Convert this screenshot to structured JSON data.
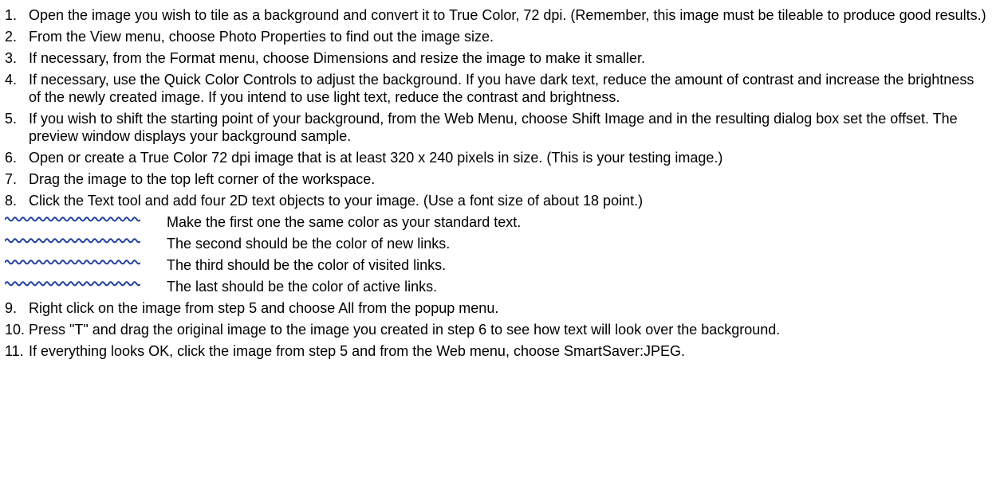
{
  "steps_before": [
    {
      "num": "1.",
      "text": "Open the image you wish to tile as a background and convert it to True Color, 72 dpi. (Remember, this image must be tileable to produce good results.)"
    },
    {
      "num": "2.",
      "text": "From the View menu, choose Photo Properties to find out the image size."
    },
    {
      "num": "3.",
      "text": "If necessary, from the Format menu, choose Dimensions and resize the image to make it smaller."
    },
    {
      "num": "4.",
      "text": "If necessary, use the Quick Color Controls to adjust the background. If you have dark text, reduce the amount of contrast and increase the brightness of the newly created image. If you intend to use light text, reduce the contrast and brightness."
    },
    {
      "num": "5.",
      "text": "If you wish to shift the starting point of your background, from the Web Menu, choose Shift Image and in the resulting dialog box set the offset. The preview window displays your background sample."
    },
    {
      "num": "6.",
      "text": "Open or create a True Color 72 dpi image that is at least 320 x 240 pixels in size. (This is your testing image.)"
    },
    {
      "num": "7.",
      "text": "Drag the image to the top left corner of the workspace."
    },
    {
      "num": "8.",
      "text": "Click the Text tool and add four 2D text objects to your image. (Use a font size of about 18 point.)"
    }
  ],
  "sub_items": [
    {
      "icon": "wave-bullet-icon",
      "text": "Make the first one the same color as your standard text."
    },
    {
      "icon": "wave-bullet-icon",
      "text": "The second should be the color of new links."
    },
    {
      "icon": "wave-bullet-icon",
      "text": "The third should be the color of visited links."
    },
    {
      "icon": "wave-bullet-icon",
      "text": "The last should be the color of active links."
    }
  ],
  "steps_after": [
    {
      "num": "9.",
      "text": "Right click on the image from step 5 and choose All from the popup menu."
    },
    {
      "num": "10.",
      "text": "Press \"T\" and drag the original image to the image you created in step 6 to see how text will look over the background."
    },
    {
      "num": "11.",
      "text": "If everything looks OK, click the image from step 5 and from the Web menu, choose SmartSaver:JPEG."
    }
  ],
  "colors": {
    "text": "#000000",
    "wave_bullet": "#1f3fa0",
    "background": "#ffffff"
  }
}
